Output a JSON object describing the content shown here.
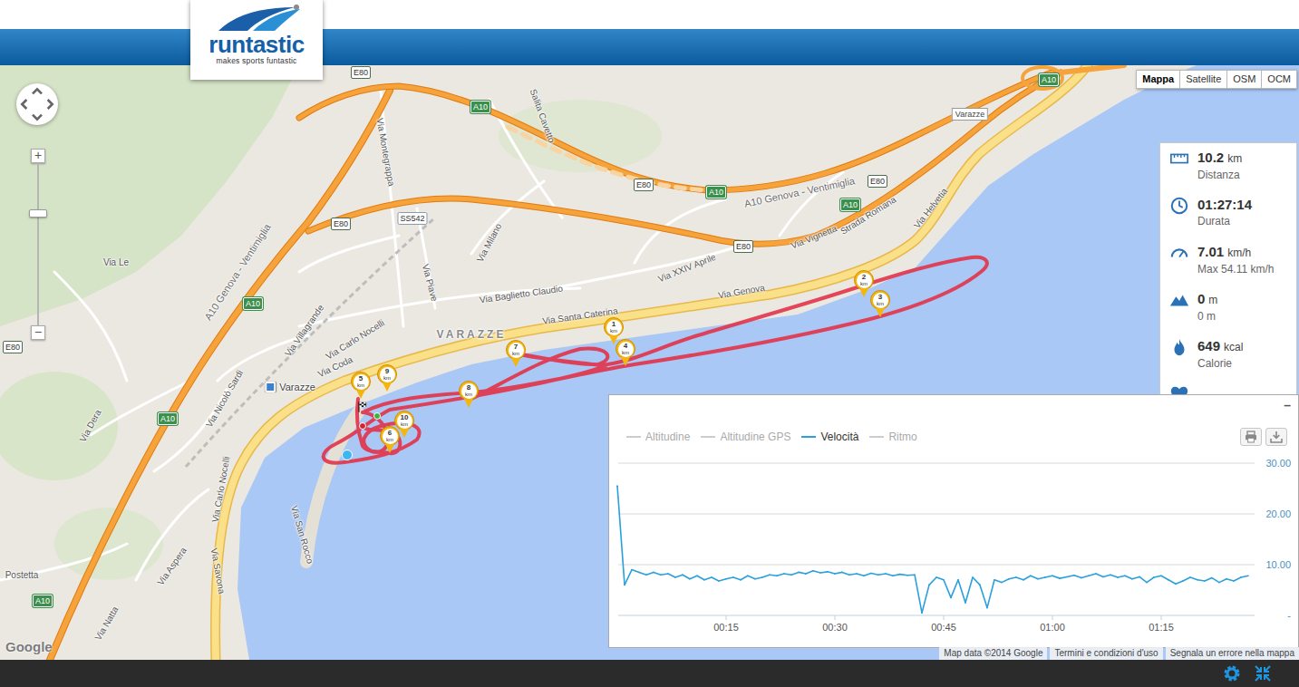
{
  "logo": {
    "name": "runtastic",
    "tagline": "makes sports funtastic"
  },
  "map_types": [
    {
      "label": "Mappa",
      "selected": true
    },
    {
      "label": "Satellite",
      "selected": false
    },
    {
      "label": "OSM",
      "selected": false
    },
    {
      "label": "OCM",
      "selected": false
    }
  ],
  "zoom": {
    "in": "+",
    "out": "−",
    "level": 0.7
  },
  "map": {
    "labels": [
      {
        "text": "Via Montegrappa",
        "kind": "street"
      },
      {
        "text": "Via Piave",
        "kind": "street"
      },
      {
        "text": "Via Milano",
        "kind": "street"
      },
      {
        "text": "Via Baglietto Claudio",
        "kind": "street"
      },
      {
        "text": "Via Santa Caterina",
        "kind": "street"
      },
      {
        "text": "Via Genova",
        "kind": "street"
      },
      {
        "text": "Via XXIV Aprile",
        "kind": "street"
      },
      {
        "text": "Via Vignetta",
        "kind": "street"
      },
      {
        "text": "Strada Romana",
        "kind": "street"
      },
      {
        "text": "Via Helvetia",
        "kind": "street"
      },
      {
        "text": "Via Carlo Nocelli",
        "kind": "street"
      },
      {
        "text": "Via Carlo Nocelli",
        "kind": "street"
      },
      {
        "text": "Via Coda",
        "kind": "street"
      },
      {
        "text": "Via Villagrande",
        "kind": "street"
      },
      {
        "text": "Via Nicolò Sardi",
        "kind": "street"
      },
      {
        "text": "Via Savona",
        "kind": "street"
      },
      {
        "text": "Via San Rocco",
        "kind": "street"
      },
      {
        "text": "Via Aspera",
        "kind": "street"
      },
      {
        "text": "Via Natta",
        "kind": "street"
      },
      {
        "text": "Postetta",
        "kind": "street"
      },
      {
        "text": "Via Le",
        "kind": "street"
      },
      {
        "text": "Salita Cavetto",
        "kind": "street"
      },
      {
        "text": "Via Dera",
        "kind": "street"
      },
      {
        "text": "A10 Genova - Ventimiglia",
        "kind": "highway"
      },
      {
        "text": "A10 Genova - Ventimiglia",
        "kind": "highway"
      },
      {
        "text": "VARAZZE",
        "kind": "town"
      },
      {
        "text": "Varazze",
        "kind": "station"
      },
      {
        "text": "Varazze",
        "kind": "exit"
      },
      {
        "text": "SS542",
        "kind": "ss"
      },
      {
        "text": "A10",
        "kind": "shield-a"
      },
      {
        "text": "A10",
        "kind": "shield-a"
      },
      {
        "text": "A10",
        "kind": "shield-a"
      },
      {
        "text": "A10",
        "kind": "shield-a"
      },
      {
        "text": "A10",
        "kind": "shield-a"
      },
      {
        "text": "A10",
        "kind": "shield-a"
      },
      {
        "text": "A10",
        "kind": "shield-a"
      },
      {
        "text": "E80",
        "kind": "shield-e"
      },
      {
        "text": "E80",
        "kind": "shield-e"
      },
      {
        "text": "E80",
        "kind": "shield-e"
      },
      {
        "text": "E80",
        "kind": "shield-e"
      },
      {
        "text": "E80",
        "kind": "shield-e"
      },
      {
        "text": "E80",
        "kind": "shield-e"
      }
    ],
    "markers": [
      {
        "number": "1",
        "unit": "km"
      },
      {
        "number": "2",
        "unit": "km"
      },
      {
        "number": "3",
        "unit": "km"
      },
      {
        "number": "4",
        "unit": "km"
      },
      {
        "number": "5",
        "unit": "km"
      },
      {
        "number": "6",
        "unit": "km"
      },
      {
        "number": "7",
        "unit": "km"
      },
      {
        "number": "8",
        "unit": "km"
      },
      {
        "number": "9",
        "unit": "km"
      },
      {
        "number": "10",
        "unit": "km"
      }
    ],
    "google_logo": "Google",
    "attribution": [
      "Map data ©2014 Google",
      "Termini e condizioni d'uso",
      "Segnala un errore nella mappa"
    ]
  },
  "stats": [
    {
      "value": "10.2",
      "unit": "km",
      "label": "Distanza"
    },
    {
      "value": "01:27:14",
      "label": "Durata"
    },
    {
      "value": "7.01",
      "unit": "km/h",
      "label": "Max 54.11 km/h"
    },
    {
      "value": "0",
      "unit": "m",
      "label": "0 m"
    },
    {
      "value": "649",
      "unit": "kcal",
      "label": "Calorie"
    }
  ],
  "chart": {
    "minimize": "–",
    "legend": [
      {
        "label": "Altitudine",
        "selected": false
      },
      {
        "label": "Altitudine GPS",
        "selected": false
      },
      {
        "label": "Velocità",
        "selected": true
      },
      {
        "label": "Ritmo",
        "selected": false
      }
    ],
    "y_ticks": [
      "30.00",
      "20.00",
      "10.00",
      "-"
    ],
    "x_ticks": [
      "00:15",
      "00:30",
      "00:45",
      "01:00",
      "01:15"
    ],
    "series": [
      {
        "name": "Velocità",
        "values": [
          25.5,
          6,
          9,
          8.5,
          8,
          8.5,
          8,
          8.2,
          7.5,
          8,
          7.2,
          7.8,
          7,
          7.5,
          6.8,
          7.2,
          7.5,
          7,
          7.8,
          7.2,
          7.5,
          8,
          7.8,
          8.2,
          8,
          8.5,
          8.2,
          8.8,
          8.4,
          8.6,
          8.2,
          8.5,
          8,
          8.2,
          7.8,
          8.3,
          8,
          8.2,
          7.8,
          8.1,
          7.9,
          8,
          0.5,
          6,
          7.5,
          7,
          3.5,
          7,
          2.5,
          7.5,
          6,
          1.5,
          7,
          6.5,
          7.2,
          7.5,
          7,
          7.8,
          7.2,
          7.5,
          7.8,
          7.3,
          7.6,
          7.9,
          7.4,
          7.8,
          8.2,
          7.6,
          8,
          7.5,
          7.8,
          7.2,
          7.6,
          6.5,
          7.5,
          7.8,
          7,
          6.2,
          6.8,
          7.5,
          7,
          6.8,
          7.4,
          6.5,
          7.2,
          6.8,
          7.5,
          7.8
        ]
      }
    ]
  }
}
